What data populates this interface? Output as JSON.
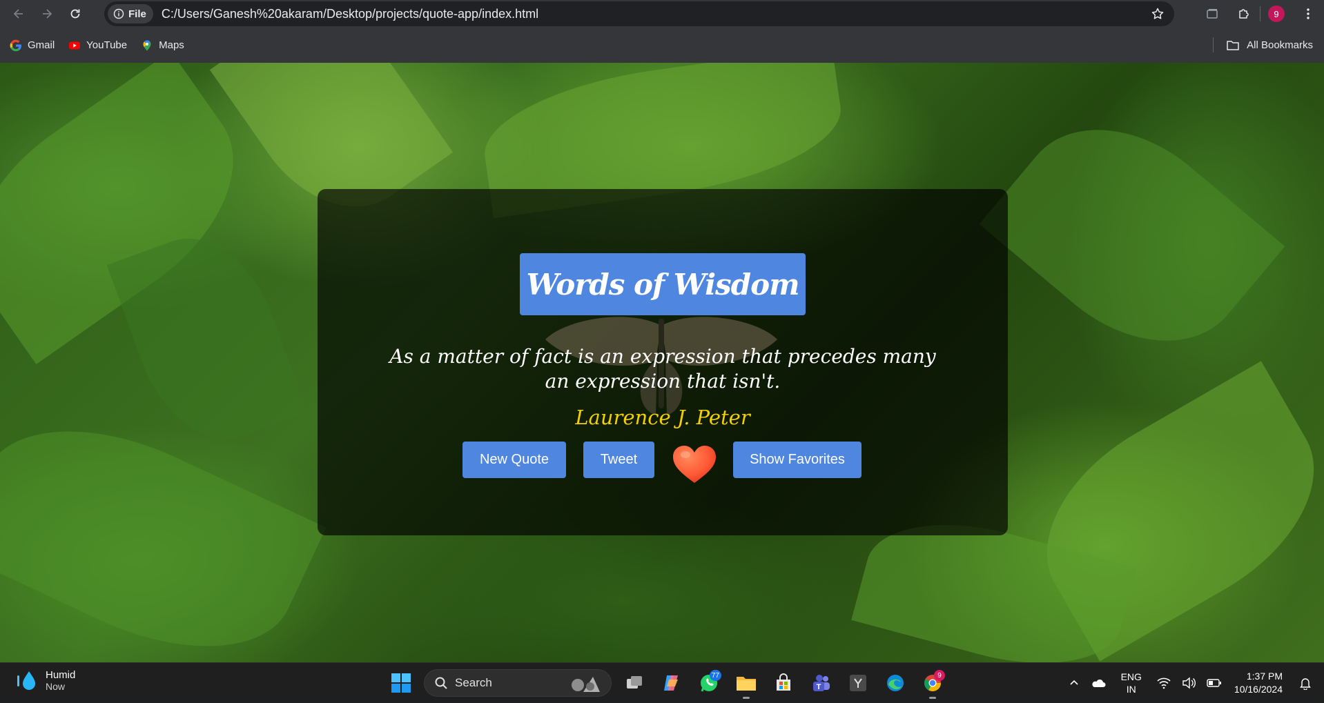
{
  "browser": {
    "chip_label": "File",
    "url": "C:/Users/Ganesh%20akaram/Desktop/projects/quote-app/index.html",
    "profile_initial": "9"
  },
  "bookmarks": {
    "items": [
      {
        "label": "Gmail",
        "icon": "google-icon"
      },
      {
        "label": "YouTube",
        "icon": "youtube-icon"
      },
      {
        "label": "Maps",
        "icon": "maps-icon"
      }
    ],
    "all_bookmarks": "All Bookmarks"
  },
  "page": {
    "title": "Words of Wisdom",
    "quote": "As a matter of fact is an expression that precedes many an expression that isn't.",
    "author": "Laurence J. Peter",
    "buttons": {
      "new_quote": "New Quote",
      "tweet": "Tweet",
      "favorite": "heart-icon",
      "show_favorites": "Show Favorites"
    },
    "colors": {
      "accent": "#4f86e0",
      "author": "#f4d000",
      "heart": "#ff5a36"
    }
  },
  "taskbar": {
    "weather_title": "Humid",
    "weather_sub": "Now",
    "search_placeholder": "Search",
    "whatsapp_badge": "77",
    "chrome_badge": "9",
    "lang_line1": "ENG",
    "lang_line2": "IN",
    "time": "1:37 PM",
    "date": "10/16/2024"
  }
}
